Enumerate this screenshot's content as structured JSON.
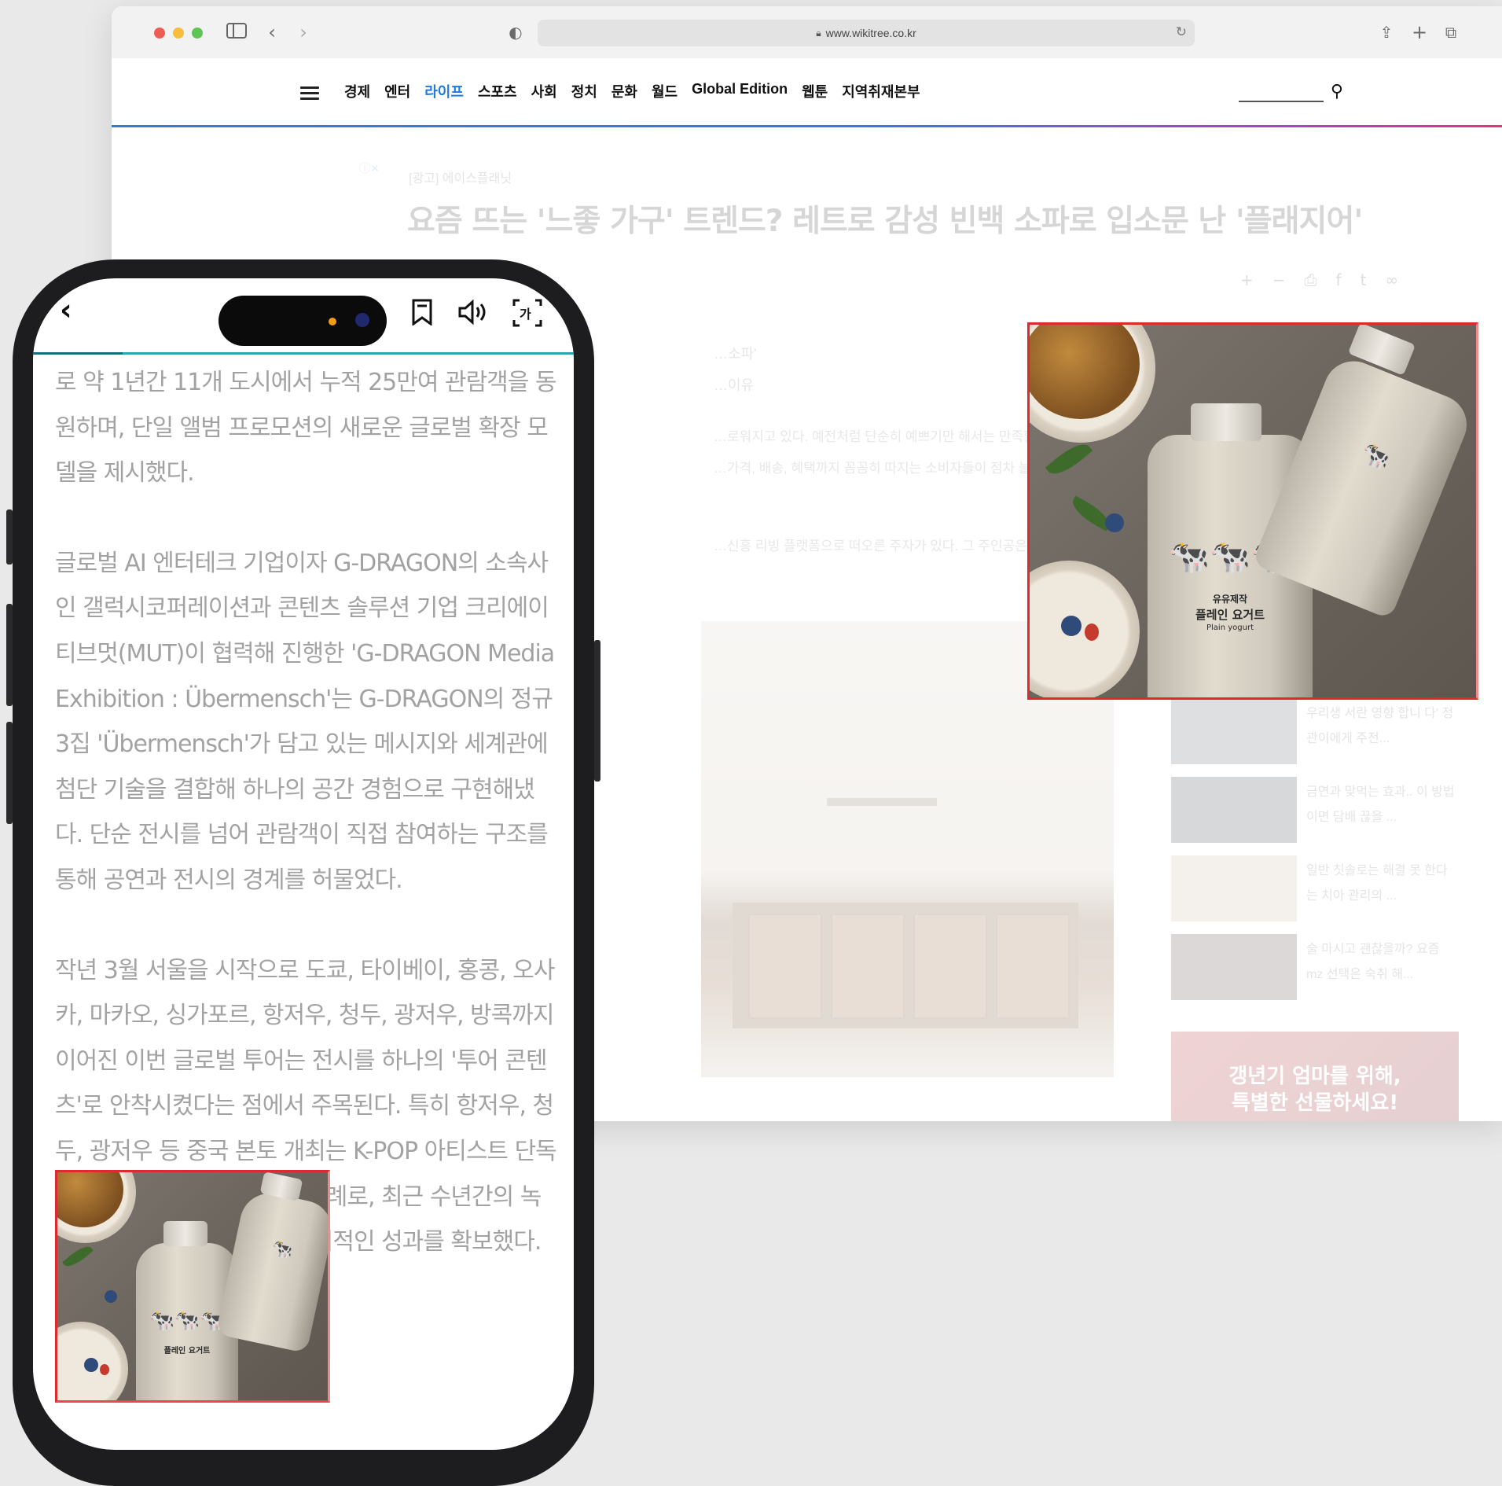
{
  "browser": {
    "url": "www.wikitree.co.kr",
    "nav": {
      "items": [
        "경제",
        "엔터",
        "라이프",
        "스포츠",
        "사회",
        "정치",
        "문화",
        "월드",
        "Global Edition",
        "웹툰",
        "지역취재본부"
      ],
      "active_index": 2
    },
    "ad_tag": "[광고] 에이스플래닛",
    "headline": "요즘 뜨는 '느좋 가구' 트렌드? 레트로 감성 빈백 소파로 입소문 난 '플래지어'",
    "snippets": [
      "…소파'",
      "…이유"
    ],
    "body_lines": [
      "…로워지고 있다. 예전처럼 단순히 예쁘기만 해서는 만족할 수",
      "…가격, 배송, 혜택까지 꼼꼼히 따지는 소비자들이 점차 늘고 있"
    ],
    "body_line3": "…신흥 리빙 플랫폼으로 떠오른 주자가 있다. 그 주인공은 바",
    "sidebar": [
      {
        "title": "우리생 서란 영향 합니 다' 정관이에게 주전..."
      },
      {
        "title": "금연과 맞먹는 효과.. 이 방법이면 담배 끊을 ..."
      },
      {
        "title": "일반 칫솔로는 해결 못 한다는 치아 관리의 ..."
      },
      {
        "title": "술 마시고 괜찮을까? 요즘 mz 선택은 숙취 해..."
      }
    ],
    "side_ad": {
      "line1": "갱년기 엄마를 위해,",
      "line2": "특별한 선물하세요!"
    }
  },
  "phone": {
    "paragraphs": [
      "로 약 1년간 11개 도시에서 누적 25만여 관람객을 동원하며, 단일 앨범 프로모션의 새로운 글로벌 확장 모델을 제시했다.",
      "글로벌 AI 엔터테크 기업이자 G-DRAGON의 소속사인 갤럭시코퍼레이션과 콘텐츠 솔루션 기업 크리에이티브멋(MUT)이 협력해 진행한 'G-DRAGON Media Exhibition : Übermensch'는 G-DRAGON의 정규 3집 'Übermensch'가 담고 있는 메시지와 세계관에 첨단 기술을 결합해 하나의 공간 경험으로 구현해냈다. 단순 전시를 넘어 관람객이 직접 참여하는 구조를 통해 공연과 전시의 경계를 허물었다.",
      "작년 3월 서울을 시작으로 도쿄, 타이베이, 홍콩, 오사카, 마카오, 싱가포르, 항저우, 청두, 광저우, 방콕까지 이어진 이번 글로벌 투어는 전시를 하나의 '투어 콘텐츠'로 안착시켰다는 점에서 주목된다. 특히 항저우, 청두, 광저우 등 중국 본토 개최는 K-POP 아티스트 단독 전시로서는 매우 이례적인 사례로, 최근 수년간의 녹록지 않은 환경 속에서도 가시적인 성과를 확보했다."
    ]
  },
  "product": {
    "label_main": "유유제작",
    "label_name": "플레인 요거트",
    "label_sub": "Plain yogurt"
  },
  "colors": {
    "accent": "#1f7be0",
    "highlight_border": "#dd2a2f",
    "progress": "#2da7b8"
  }
}
